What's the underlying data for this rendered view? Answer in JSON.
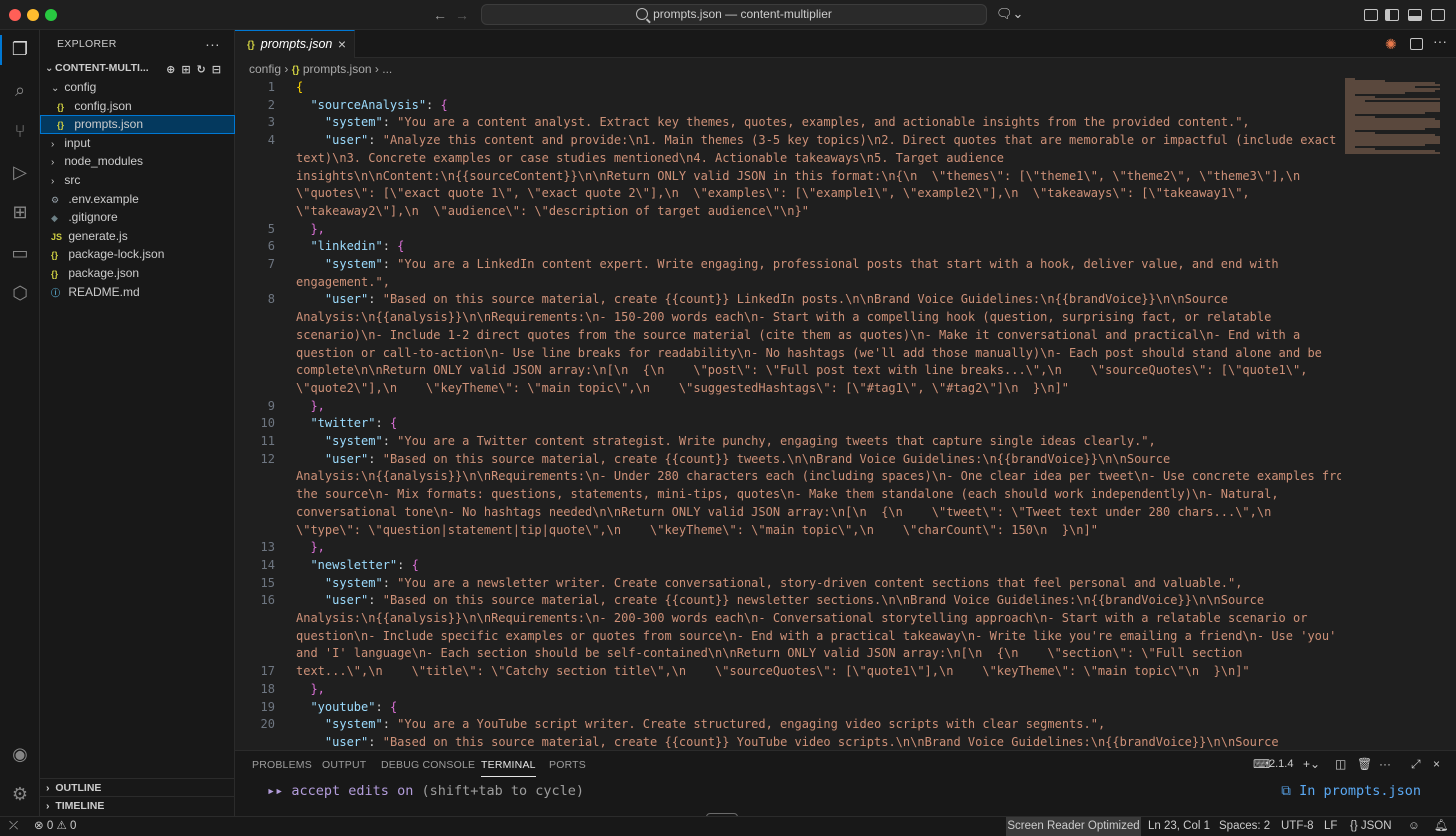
{
  "window": {
    "title": "prompts.json — content-multiplier"
  },
  "activity": [
    "explorer-icon",
    "search-icon",
    "source-control-icon",
    "run-debug-icon",
    "extensions-icon",
    "remote-icon",
    "containers-icon",
    "account-icon",
    "settings-gear-icon"
  ],
  "sidebar": {
    "header": "EXPLORER",
    "project": "CONTENT-MULTI...",
    "tree": [
      {
        "label": "config",
        "type": "folder",
        "open": true,
        "depth": 1
      },
      {
        "label": "config.json",
        "type": "json",
        "depth": 2
      },
      {
        "label": "prompts.json",
        "type": "json",
        "depth": 2,
        "selected": true
      },
      {
        "label": "input",
        "type": "folder",
        "open": false,
        "depth": 1
      },
      {
        "label": "node_modules",
        "type": "folder",
        "open": false,
        "depth": 1
      },
      {
        "label": "src",
        "type": "folder",
        "open": false,
        "depth": 1
      },
      {
        "label": ".env.example",
        "type": "gear",
        "depth": 1
      },
      {
        "label": ".gitignore",
        "type": "git",
        "depth": 1
      },
      {
        "label": "generate.js",
        "type": "js",
        "depth": 1
      },
      {
        "label": "package-lock.json",
        "type": "json",
        "depth": 1
      },
      {
        "label": "package.json",
        "type": "json",
        "depth": 1
      },
      {
        "label": "README.md",
        "type": "info",
        "depth": 1
      }
    ],
    "outline": "OUTLINE",
    "timeline": "TIMELINE"
  },
  "editor": {
    "tab_label": "prompts.json",
    "breadcrumb": [
      "config",
      "prompts.json",
      "..."
    ],
    "line_numbers": [
      "1",
      "2",
      "3",
      "4",
      "",
      "",
      "",
      "",
      "5",
      "6",
      "7",
      "",
      "8",
      "",
      "",
      "",
      "",
      "",
      "9",
      "10",
      "11",
      "12",
      "",
      "",
      "",
      "",
      "13",
      "14",
      "15",
      "16",
      "",
      "",
      "",
      "17",
      "18",
      "19",
      "20"
    ],
    "lines": [
      "{",
      "  \"sourceAnalysis\": {",
      "    \"system\": \"You are a content analyst. Extract key themes, quotes, examples, and actionable insights from the provided content.\",",
      "    \"user\": \"Analyze this content and provide:\\n1. Main themes (3-5 key topics)\\n2. Direct quotes that are memorable or impactful (include exact",
      "text)\\n3. Concrete examples or case studies mentioned\\n4. Actionable takeaways\\n5. Target audience",
      "insights\\n\\nContent:\\n{{sourceContent}}\\n\\nReturn ONLY valid JSON in this format:\\n{\\n  \\\"themes\\\": [\\\"theme1\\\", \\\"theme2\\\", \\\"theme3\\\"],\\n",
      "\\\"quotes\\\": [\\\"exact quote 1\\\", \\\"exact quote 2\\\"],\\n  \\\"examples\\\": [\\\"example1\\\", \\\"example2\\\"],\\n  \\\"takeaways\\\": [\\\"takeaway1\\\",",
      "\\\"takeaway2\\\"],\\n  \\\"audience\\\": \\\"description of target audience\\\"\\n}\"",
      "  },",
      "  \"linkedin\": {",
      "    \"system\": \"You are a LinkedIn content expert. Write engaging, professional posts that start with a hook, deliver value, and end with",
      "engagement.\",",
      "    \"user\": \"Based on this source material, create {{count}} LinkedIn posts.\\n\\nBrand Voice Guidelines:\\n{{brandVoice}}\\n\\nSource",
      "Analysis:\\n{{analysis}}\\n\\nRequirements:\\n- 150-200 words each\\n- Start with a compelling hook (question, surprising fact, or relatable",
      "scenario)\\n- Include 1-2 direct quotes from the source material (cite them as quotes)\\n- Make it conversational and practical\\n- End with a",
      "question or call-to-action\\n- Use line breaks for readability\\n- No hashtags (we'll add those manually)\\n- Each post should stand alone and be",
      "complete\\n\\nReturn ONLY valid JSON array:\\n[\\n  {\\n    \\\"post\\\": \\\"Full post text with line breaks...\\\",\\n    \\\"sourceQuotes\\\": [\\\"quote1\\\",",
      "\\\"quote2\\\"],\\n    \\\"keyTheme\\\": \\\"main topic\\\",\\n    \\\"suggestedHashtags\\\": [\\\"#tag1\\\", \\\"#tag2\\\"]\\n  }\\n]\"",
      "  },",
      "  \"twitter\": {",
      "    \"system\": \"You are a Twitter content strategist. Write punchy, engaging tweets that capture single ideas clearly.\",",
      "    \"user\": \"Based on this source material, create {{count}} tweets.\\n\\nBrand Voice Guidelines:\\n{{brandVoice}}\\n\\nSource",
      "Analysis:\\n{{analysis}}\\n\\nRequirements:\\n- Under 280 characters each (including spaces)\\n- One clear idea per tweet\\n- Use concrete examples from",
      "the source\\n- Mix formats: questions, statements, mini-tips, quotes\\n- Make them standalone (each should work independently)\\n- Natural,",
      "conversational tone\\n- No hashtags needed\\n\\nReturn ONLY valid JSON array:\\n[\\n  {\\n    \\\"tweet\\\": \\\"Tweet text under 280 chars...\\\",\\n",
      "\\\"type\\\": \\\"question|statement|tip|quote\\\",\\n    \\\"keyTheme\\\": \\\"main topic\\\",\\n    \\\"charCount\\\": 150\\n  }\\n]\"",
      "  },",
      "  \"newsletter\": {",
      "    \"system\": \"You are a newsletter writer. Create conversational, story-driven content sections that feel personal and valuable.\",",
      "    \"user\": \"Based on this source material, create {{count}} newsletter sections.\\n\\nBrand Voice Guidelines:\\n{{brandVoice}}\\n\\nSource",
      "Analysis:\\n{{analysis}}\\n\\nRequirements:\\n- 200-300 words each\\n- Conversational storytelling approach\\n- Start with a relatable scenario or",
      "question\\n- Include specific examples or quotes from source\\n- End with a practical takeaway\\n- Write like you're emailing a friend\\n- Use 'you'",
      "and 'I' language\\n- Each section should be self-contained\\n\\nReturn ONLY valid JSON array:\\n[\\n  {\\n    \\\"section\\\": \\\"Full section",
      "text...\\\",\\n    \\\"title\\\": \\\"Catchy section title\\\",\\n    \\\"sourceQuotes\\\": [\\\"quote1\\\"],\\n    \\\"keyTheme\\\": \\\"main topic\\\"\\n  }\\n]\"",
      "  },",
      "  \"youtube\": {",
      "    \"system\": \"You are a YouTube script writer. Create structured, engaging video scripts with clear segments.\",",
      "    \"user\": \"Based on this source material, create {{count}} YouTube video scripts.\\n\\nBrand Voice Guidelines:\\n{{brandVoice}}\\n\\nSource"
    ]
  },
  "panel": {
    "tabs": [
      "PROBLEMS",
      "OUTPUT",
      "DEBUG CONSOLE",
      "TERMINAL",
      "PORTS"
    ],
    "active_tab": "TERMINAL",
    "terminal_version": "2.1.4",
    "terminal_prompt": "▸▸",
    "terminal_text": "accept edits on",
    "terminal_hint": "(shift+tab to cycle)",
    "terminal_right": "In prompts.json"
  },
  "status": {
    "errors": "0",
    "warnings": "0",
    "screen_reader": "Screen Reader Optimized",
    "position": "Ln 23, Col 1",
    "spaces": "Spaces: 2",
    "encoding": "UTF-8",
    "eol": "LF",
    "language": "JSON"
  }
}
